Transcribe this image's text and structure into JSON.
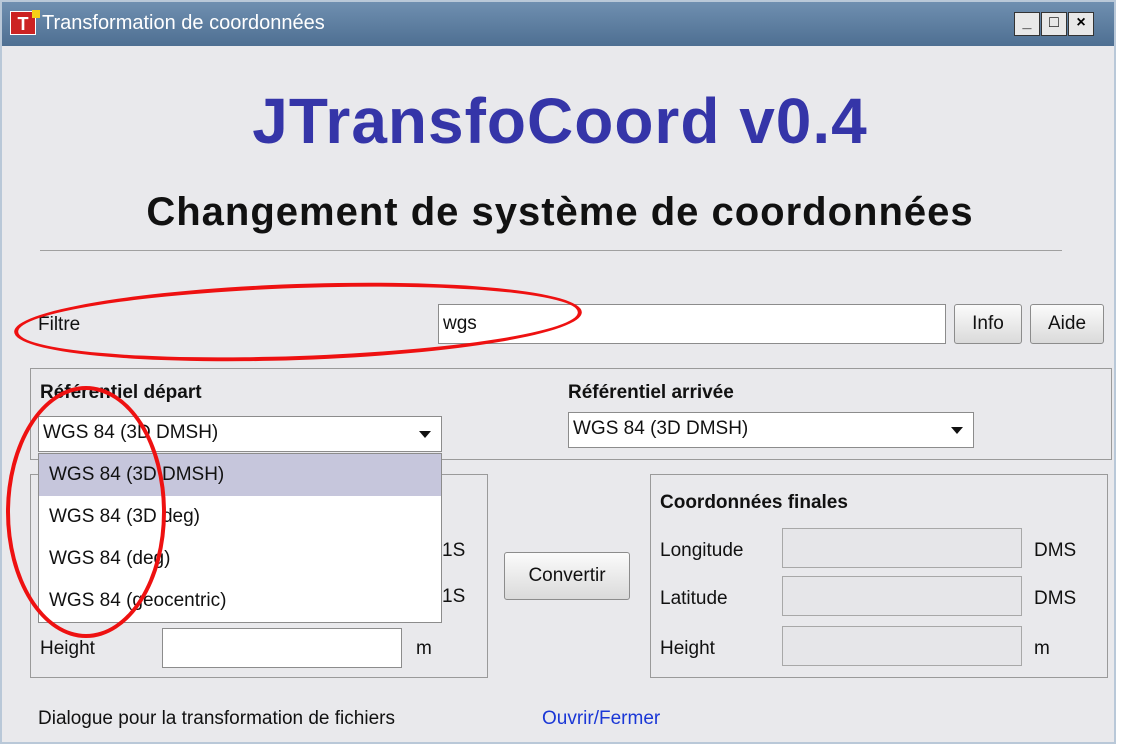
{
  "window": {
    "title": "Transformation de coordonnées",
    "app_icon": "T",
    "min": "_",
    "max": "□",
    "close": "×"
  },
  "header": {
    "title": "JTransfoCoord v0.4",
    "subtitle": "Changement de système de coordonnées"
  },
  "filter": {
    "label": "Filtre",
    "value": "wgs",
    "info_button": "Info",
    "help_button": "Aide"
  },
  "departure": {
    "label": "Référentiel départ",
    "selected": "WGS 84 (3D DMSH)",
    "options": [
      "WGS 84 (3D DMSH)",
      "WGS 84 (3D deg)",
      "WGS 84 (deg)",
      "WGS 84 (geocentric)"
    ],
    "height_label": "Height",
    "height_unit": "m",
    "partial_unit_1": "1S",
    "partial_unit_2": "1S"
  },
  "arrival": {
    "label": "Référentiel arrivée",
    "selected": "WGS 84 (3D DMSH)"
  },
  "convert_button": "Convertir",
  "final": {
    "title": "Coordonnées finales",
    "longitude_label": "Longitude",
    "longitude_unit": "DMS",
    "latitude_label": "Latitude",
    "latitude_unit": "DMS",
    "height_label": "Height",
    "height_unit": "m"
  },
  "footer": {
    "label": "Dialogue pour la transformation de fichiers",
    "link": "Ouvrir/Fermer"
  },
  "colors": {
    "title_blue": "#3535a8",
    "link_blue": "#1a37d6",
    "annotation_red": "#e11111",
    "selection": "#c6c6dc"
  }
}
